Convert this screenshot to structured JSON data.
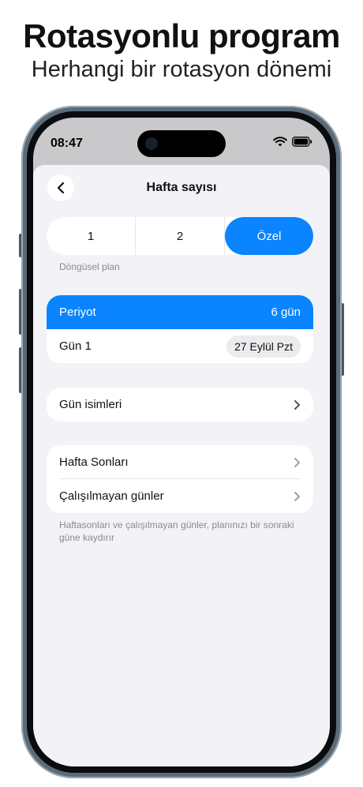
{
  "marketing": {
    "headline": "Rotasyonlu program",
    "subheadline": "Herhangi bir rotasyon dönemi"
  },
  "status_bar": {
    "time": "08:47",
    "icons": [
      "wifi-icon",
      "battery-icon"
    ]
  },
  "nav": {
    "title": "Hafta sayısı",
    "back_icon": "chevron-left-icon"
  },
  "segmented": {
    "options": [
      "1",
      "2",
      "Özel"
    ],
    "selected": "Özel",
    "caption": "Döngüsel plan"
  },
  "period_card": {
    "period_label": "Periyot",
    "period_value": "6 gün",
    "day_label": "Gün 1",
    "day_value": "27 Eylül Pzt"
  },
  "day_names": {
    "label": "Gün isimleri"
  },
  "weekend_card": {
    "weekends_label": "Hafta Sonları",
    "nonworking_label": "Çalışılmayan günler",
    "footnote": "Haftasonları ve çalışılmayan günler, planınızı bir sonraki güne kaydırır"
  },
  "colors": {
    "accent": "#0a84ff",
    "background": "#f2f2f7",
    "card": "#ffffff",
    "secondary_text": "#8a8a8e"
  }
}
